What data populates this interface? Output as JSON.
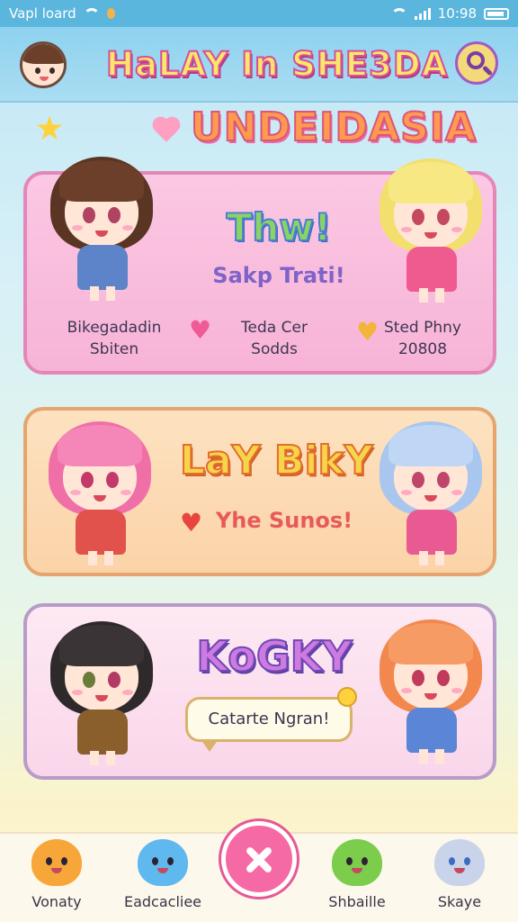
{
  "status_bar": {
    "carrier": "Vapl loard",
    "time": "10:98"
  },
  "header": {
    "title": "HaLAY In SHE3DA",
    "avatar_icon": "user-avatar-icon",
    "search_icon": "search-icon"
  },
  "section": {
    "title": "UNDEIDASIA"
  },
  "cards": [
    {
      "heading": "Thw!",
      "subtitle": "Sakp Trati!",
      "stats": [
        {
          "line1": "Bikegadadin",
          "line2": "Sbiten"
        },
        {
          "line1": "Teda Cer",
          "line2": "Sodds"
        },
        {
          "line1": "Sted Phny",
          "line2": "20808"
        }
      ]
    },
    {
      "heading": "LaY BikY",
      "subtitle": "Yhe Sunos!"
    },
    {
      "heading": "KoGKY",
      "speech": "Catarte Ngran!"
    }
  ],
  "bottom_nav": {
    "items": [
      {
        "label": "Vonaty",
        "icon": "orange-mascot-icon"
      },
      {
        "label": "Eadcacliee",
        "icon": "blue-mascot-icon"
      },
      {
        "label": "Shbaille",
        "icon": "green-mascot-icon"
      },
      {
        "label": "Skaye",
        "icon": "cat-avatar-icon"
      }
    ],
    "center_button_icon": "close-icon"
  },
  "colors": {
    "status_bar": "#5bb6dd",
    "header": "#a9ddf2",
    "card1": "#f7b3d6",
    "card2": "#fbd3a8",
    "card3": "#fad6ea",
    "fab": "#f56aa4"
  }
}
